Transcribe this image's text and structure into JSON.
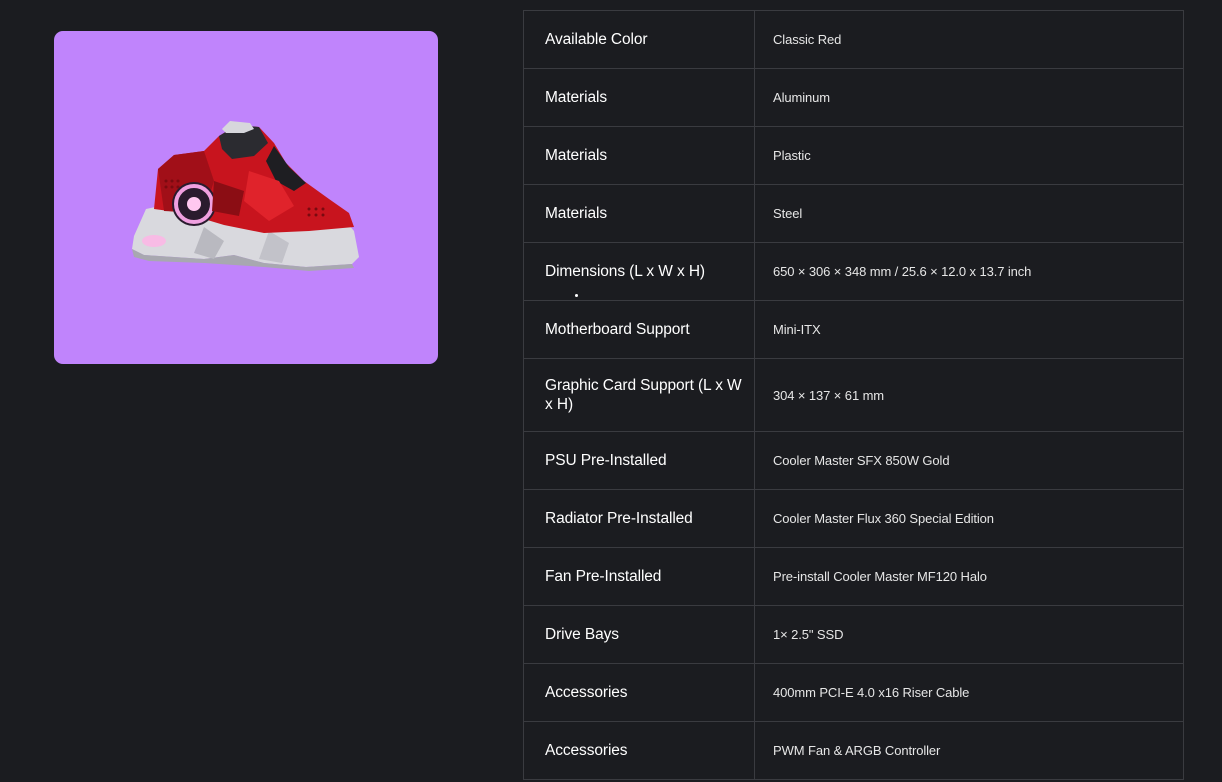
{
  "product": {
    "image_icon": "shoe-shaped-pc-case-image",
    "background_color": "#c084fc"
  },
  "specs": [
    {
      "label": "Available Color",
      "value": "Classic Red"
    },
    {
      "label": "Materials",
      "value": "Aluminum"
    },
    {
      "label": "Materials",
      "value": "Plastic"
    },
    {
      "label": "Materials",
      "value": "Steel"
    },
    {
      "label": "Dimensions (L x W x H)",
      "value": "650 × 306 × 348 mm / 25.6 × 12.0 x 13.7 inch"
    },
    {
      "label": "Motherboard Support",
      "value": "Mini-ITX"
    },
    {
      "label": "Graphic Card Support (L x W x H)",
      "value": "304 × 137 × 61 mm"
    },
    {
      "label": "PSU Pre-Installed",
      "value": "Cooler Master SFX 850W Gold"
    },
    {
      "label": "Radiator Pre-Installed",
      "value": "Cooler Master Flux 360 Special Edition"
    },
    {
      "label": "Fan Pre-Installed",
      "value": "Pre-install Cooler Master MF120 Halo"
    },
    {
      "label": "Drive Bays",
      "value": "1× 2.5\" SSD"
    },
    {
      "label": "Accessories",
      "value": "400mm PCI-E 4.0 x16 Riser Cable"
    },
    {
      "label": "Accessories",
      "value": "PWM Fan & ARGB Controller"
    }
  ]
}
